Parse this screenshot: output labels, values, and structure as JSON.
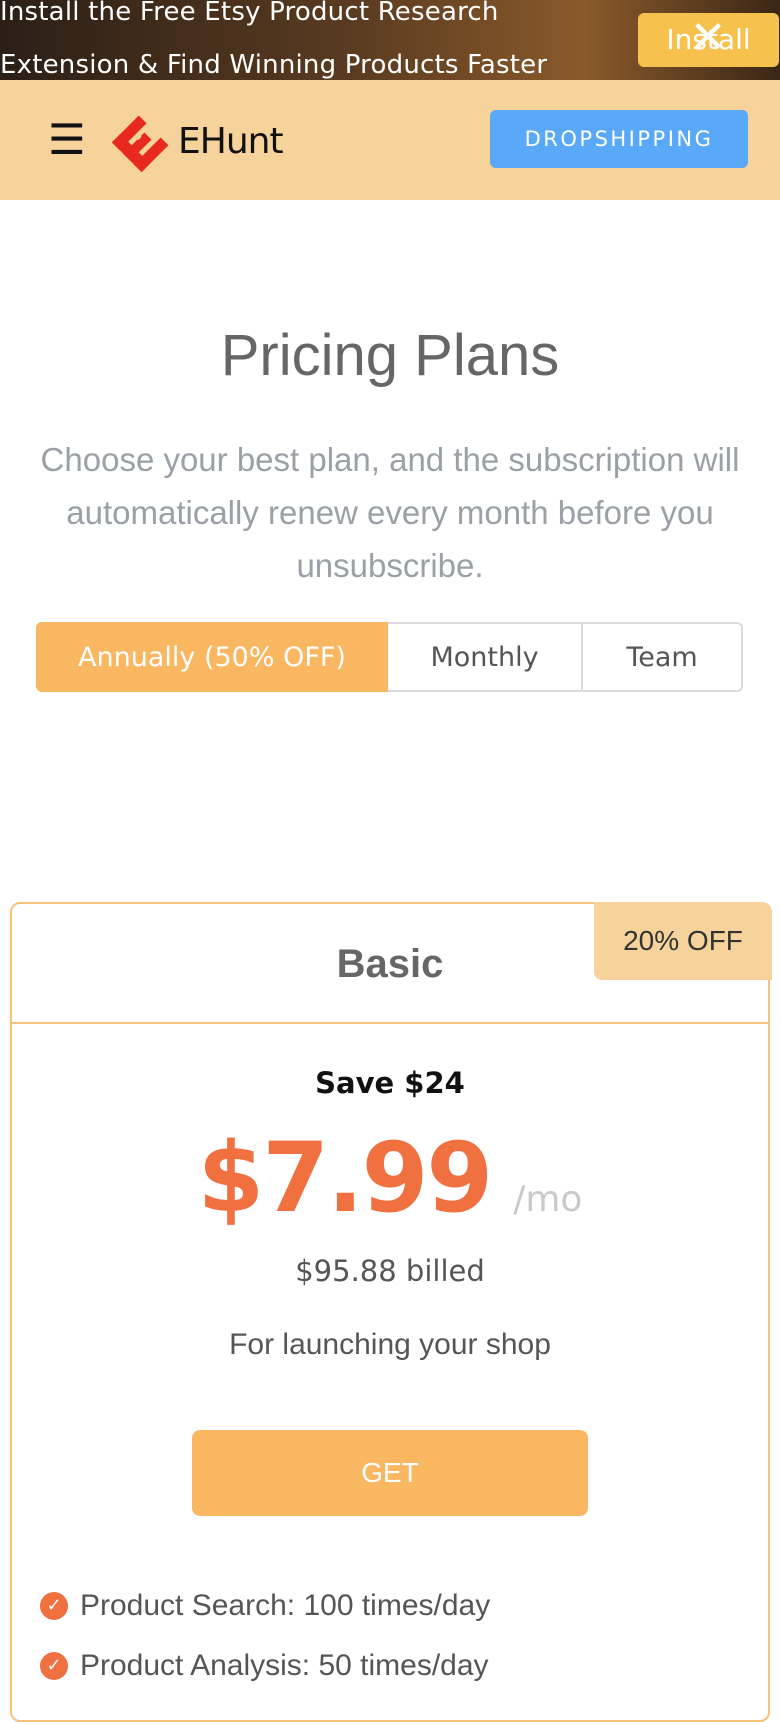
{
  "banner": {
    "text": "Install the Free Etsy Product Research Extension & Find Winning Products Faster",
    "install_label": "Install",
    "close_icon": "close-icon"
  },
  "header": {
    "menu_icon": "☰",
    "logo_text": "EHunt",
    "dropshipping_label": "DROPSHIPPING",
    "colors": {
      "bar": "#f6d39b",
      "button": "#5aa9f8",
      "logo_mark": "#e82a1e"
    }
  },
  "hero": {
    "title": "Pricing Plans",
    "subtitle": "Choose your best plan, and the subscription will automatically renew every month before you unsubscribe."
  },
  "tabs": [
    {
      "label": "Annually (50% OFF)",
      "active": true
    },
    {
      "label": "Monthly",
      "active": false
    },
    {
      "label": "Team",
      "active": false
    }
  ],
  "plan": {
    "name": "Basic",
    "badge": "20% OFF",
    "save": "Save $24",
    "price": "$7.99",
    "per": "/mo",
    "billed": "$95.88 billed",
    "tagline": "For launching your shop",
    "cta": "GET",
    "features": [
      "Product Search: 100 times/day",
      "Product Analysis: 50 times/day"
    ],
    "colors": {
      "accent": "#f07040",
      "button": "#fab762",
      "border": "#f6c27a"
    }
  }
}
